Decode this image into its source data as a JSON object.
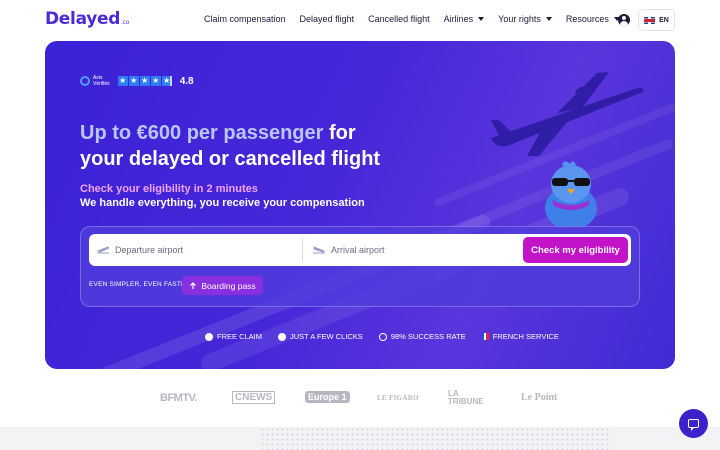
{
  "brand": {
    "name": "Delayed",
    "suffix": ".co",
    "color": "#4a2bd6"
  },
  "nav": {
    "items": [
      {
        "label": "Claim compensation",
        "dropdown": false
      },
      {
        "label": "Delayed flight",
        "dropdown": false
      },
      {
        "label": "Cancelled flight",
        "dropdown": false
      },
      {
        "label": "Airlines",
        "dropdown": true
      },
      {
        "label": "Your rights",
        "dropdown": true
      },
      {
        "label": "Resources",
        "dropdown": true
      }
    ],
    "account_icon": "user-circle-icon",
    "language": {
      "code": "EN",
      "flag": "uk-flag-icon"
    }
  },
  "hero": {
    "rating": {
      "provider_line1": "Avis",
      "provider_line2": "Vérifiés",
      "stars": 4.8,
      "value": "4.8"
    },
    "headline_accent": "Up to €600 per passenger",
    "headline_rest": " for",
    "headline_line2": "your delayed or cancelled flight",
    "subtitle_1": "Check your eligibility in 2 minutes",
    "subtitle_2": "We handle everything, you receive your compensation",
    "search": {
      "departure_placeholder": "Departure airport",
      "arrival_placeholder": "Arrival airport",
      "submit_label": "Check my eligibility"
    },
    "simpler_text": "EVEN SIMPLER, EVEN FASTER:",
    "boarding_pass_label": "Boarding pass",
    "features": [
      {
        "label": "FREE CLAIM",
        "icon": "euro-icon"
      },
      {
        "label": "JUST A FEW CLICKS",
        "icon": "click-icon"
      },
      {
        "label": "98% SUCCESS RATE",
        "icon": "target-icon"
      },
      {
        "label": "FRENCH SERVICE",
        "icon": "french-flag-icon"
      }
    ],
    "colors": {
      "accent": "#c213c9",
      "background": "#4627d8",
      "subtitle": "#f2a3ff"
    }
  },
  "press": [
    "BFMTV.",
    "CNEWS",
    "Europe 1",
    "LE FIGARO",
    "LA TRIBUNE",
    "Le Point"
  ],
  "chat": {
    "icon": "chat-icon"
  }
}
